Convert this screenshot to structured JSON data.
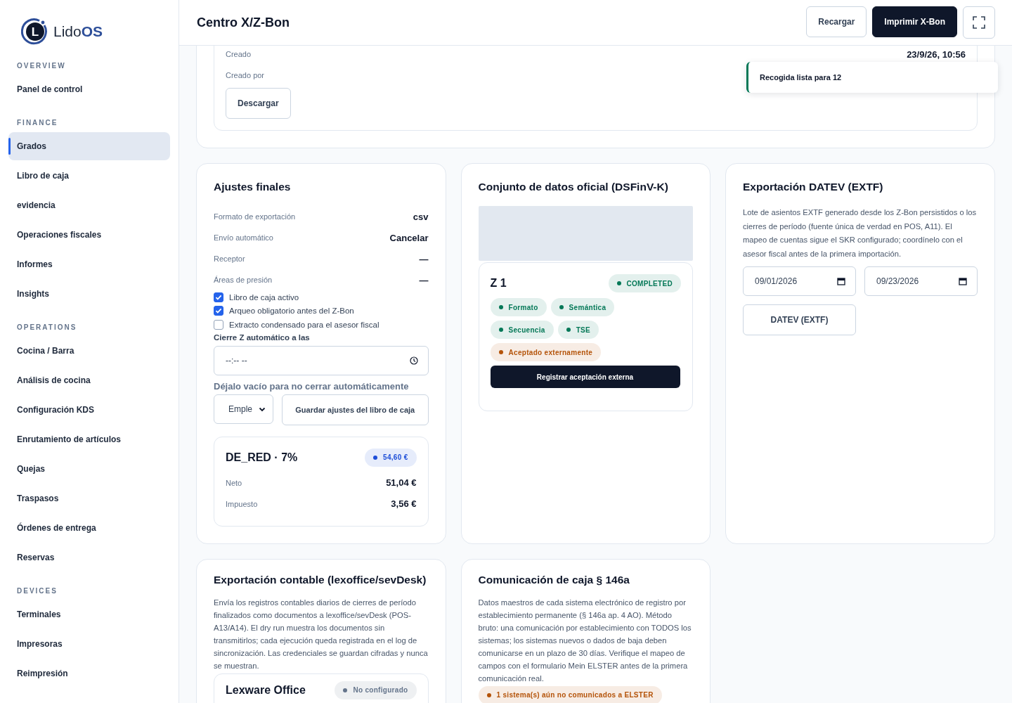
{
  "logo": {
    "mark": "L",
    "text": "Lido",
    "accent": "OS"
  },
  "sidebar": {
    "groups": [
      {
        "label": "OVERVIEW",
        "items": [
          {
            "label": "Panel de control",
            "selected": false
          }
        ]
      },
      {
        "label": "FINANCE",
        "items": [
          {
            "label": "Grados",
            "selected": true
          },
          {
            "label": "Libro de caja",
            "selected": false
          },
          {
            "label": "evidencia",
            "selected": false
          },
          {
            "label": "Operaciones fiscales",
            "selected": false
          },
          {
            "label": "Informes",
            "selected": false
          },
          {
            "label": "Insights",
            "selected": false
          }
        ]
      },
      {
        "label": "OPERATIONS",
        "items": [
          {
            "label": "Cocina / Barra",
            "selected": false
          },
          {
            "label": "Análisis de cocina",
            "selected": false
          },
          {
            "label": "Configuración KDS",
            "selected": false
          },
          {
            "label": "Enrutamiento de artículos",
            "selected": false
          },
          {
            "label": "Quejas",
            "selected": false
          },
          {
            "label": "Traspasos",
            "selected": false
          },
          {
            "label": "Órdenes de entrega",
            "selected": false
          },
          {
            "label": "Reservas",
            "selected": false
          }
        ]
      },
      {
        "label": "DEVICES",
        "items": [
          {
            "label": "Terminales",
            "selected": false
          },
          {
            "label": "Impresoras",
            "selected": false
          },
          {
            "label": "Reimpresión",
            "selected": false
          }
        ]
      }
    ]
  },
  "header": {
    "title": "Centro X/Z-Bon",
    "buttons": [
      {
        "label": "Recargar",
        "kind": "secondary"
      },
      {
        "label": "Imprimir X-Bon",
        "kind": "primary"
      }
    ]
  },
  "top_card": {
    "rows": [
      {
        "label": "Creado",
        "value": "23/9/26, 10:56"
      },
      {
        "label": "Creado por",
        "value": ""
      }
    ],
    "button": "Descargar"
  },
  "toast": {
    "text": "Recogida lista para 12"
  },
  "final_settings": {
    "title": "Ajustes finales",
    "rows": [
      {
        "label": "Formato de exportación",
        "value": "csv"
      },
      {
        "label": "Envío automático",
        "value": "Cancelar"
      },
      {
        "label": "Receptor",
        "value": "—"
      },
      {
        "label": "Áreas de presión",
        "value": "—"
      }
    ],
    "checkboxes": [
      {
        "label": "Libro de caja activo",
        "checked": true
      },
      {
        "label": "Arqueo obligatorio antes del Z-Bon",
        "checked": true
      },
      {
        "label": "Extracto condensado para el asesor fiscal",
        "checked": false
      }
    ],
    "time_label": "Cierre Z automático a las",
    "time_value": "--:-- --",
    "hint": "Déjalo vacío para no cerrar automáticamente",
    "select": "Emple",
    "save_button": "Guardar ajustes del libro de caja",
    "tax": {
      "title": "DE_RED · 7%",
      "badge": {
        "text": "54,60 €",
        "color": "#1d4ed8"
      },
      "rows": [
        {
          "label": "Neto",
          "value": "51,04 €"
        },
        {
          "label": "Impuesto",
          "value": "3,56 €"
        }
      ]
    }
  },
  "dsfinvk": {
    "title": "Conjunto de datos oficial (DSFinV-K)",
    "z": {
      "title": "Z 1",
      "status": {
        "text": "COMPLETED",
        "color": "#047857"
      },
      "badges": [
        {
          "text": "Formato",
          "color": "#047857"
        },
        {
          "text": "Semántica",
          "color": "#047857"
        },
        {
          "text": "Secuencia",
          "color": "#047857"
        },
        {
          "text": "TSE",
          "color": "#047857"
        },
        {
          "text": "Aceptado externamente",
          "color": "#b45309"
        }
      ],
      "button": "Registrar aceptación externa"
    }
  },
  "datev": {
    "title": "Exportación DATEV (EXTF)",
    "text": "Lote de asientos EXTF generado desde los Z-Bon persistidos o los cierres de período (fuente única de verdad en POS, A11). El mapeo de cuentas sigue el SKR configurado; coordínelo con el asesor fiscal antes de la primera importación.",
    "from": "09/01/2026",
    "to": "09/23/2026",
    "button": "DATEV (EXTF)"
  },
  "lexoffice": {
    "title": "Exportación contable (lexoffice/sevDesk)",
    "text": "Envía los registros contables diarios de cierres de período finalizados como documentos a lexoffice/sevDesk (POS-A13/A14). El dry run muestra los documentos sin transmitirlos; cada ejecución queda registrada en el log de sincronización. Las credenciales se guardan cifradas y nunca se muestran.",
    "provider": {
      "title": "Lexware Office",
      "badge": {
        "text": "No configurado",
        "color": "#64748b"
      }
    }
  },
  "kassen": {
    "title": "Comunicación de caja § 146a",
    "text": "Datos maestros de cada sistema electrónico de registro por establecimiento permanente (§ 146a ap. 4 AO). Método bruto: una comunicación por establecimiento con TODOS los sistemas; los sistemas nuevos o dados de baja deben comunicarse en un plazo de 30 días. Verifique el mapeo de campos con el formulario Mein ELSTER antes de la primera comunicación real.",
    "badge": {
      "text": "1 sistema(s) aún no comunicados a ELSTER",
      "color": "#b45309"
    }
  }
}
